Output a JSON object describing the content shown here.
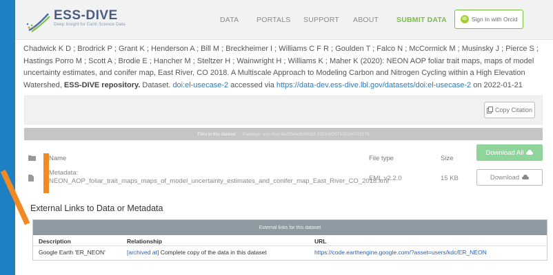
{
  "brand": {
    "name": "ESS-DIVE",
    "tagline": "Deep Insight for Earth Science Data"
  },
  "nav": [
    {
      "label": "DATA"
    },
    {
      "label": "PORTALS"
    },
    {
      "label": "SUPPORT"
    },
    {
      "label": "ABOUT"
    },
    {
      "label": "SUBMIT DATA"
    }
  ],
  "orcid": {
    "label": "Sign In with Orcid",
    "icon": "orcid-icon"
  },
  "citation": {
    "authors": "Chadwick K D ; Brodrick P ; Grant K ; Henderson A ; Bill M ; Breckheimer I ; Williams C F R ; Goulden T ; Falco N ; McCormick M ; Musinsky J ; Pierce S ; Hastings Porro M ; Scott A ; Brodie E ; Hancher M ; Steltzer H ; Wainwright H ; Williams K ; Maher K (2020): NEON AOP foliar trait maps, maps of model uncertainty estimates, and conifer map, East River, CO 2018. A Multiscale Approach to Modeling Carbon and Nitrogen Cycling within a High Elevation Watershed,",
    "repository": "ESS-DIVE repository.",
    "dataset_prefix": "Dataset.",
    "doi": "doi:el-usecase-2",
    "accessed_via": "accessed via",
    "url": "https://data-dev.ess-dive.lbl.gov/datasets/doi:el-usecase-2",
    "on": "on",
    "date": "2022-01-21"
  },
  "copy_citation": {
    "label": "Copy Citation",
    "icon": "clipboard-icon"
  },
  "files": {
    "bar_title": "Files in this dataset",
    "package_label": "Package: ess-dive-6a22b4adb0dc83-20210830T155240021176",
    "headers": {
      "name": "Name",
      "file_type": "File type",
      "size": "Size"
    },
    "download_all": "Download All",
    "rows": [
      {
        "name": "Metadata: NEON_AOP_foliar_trait_maps_maps_of_model_uncertainty_estimates_and_conifer_map_East_River_CO_2018.xml",
        "file_type": "EML v2.2.0",
        "size": "15 KB",
        "download": "Download"
      }
    ]
  },
  "external": {
    "title": "External Links to Data or Metadata",
    "bar_title": "External links for this dataset",
    "headers": {
      "description": "Description",
      "relationship": "Relationship",
      "url": "URL"
    },
    "rows": [
      {
        "description": "Google Earth 'ER_NEON'",
        "relationship_tag": "[archived at]",
        "relationship_text": "Complete copy of the data in this dataset",
        "url": "https://code.earthengine.google.com/?asset=users/kdc/ER_NEON"
      }
    ]
  },
  "colors": {
    "page_bg": "#1d7fc4",
    "accent_green": "#76c043",
    "annotation_orange": "#f08a24",
    "link_blue": "#2b7ac0"
  }
}
